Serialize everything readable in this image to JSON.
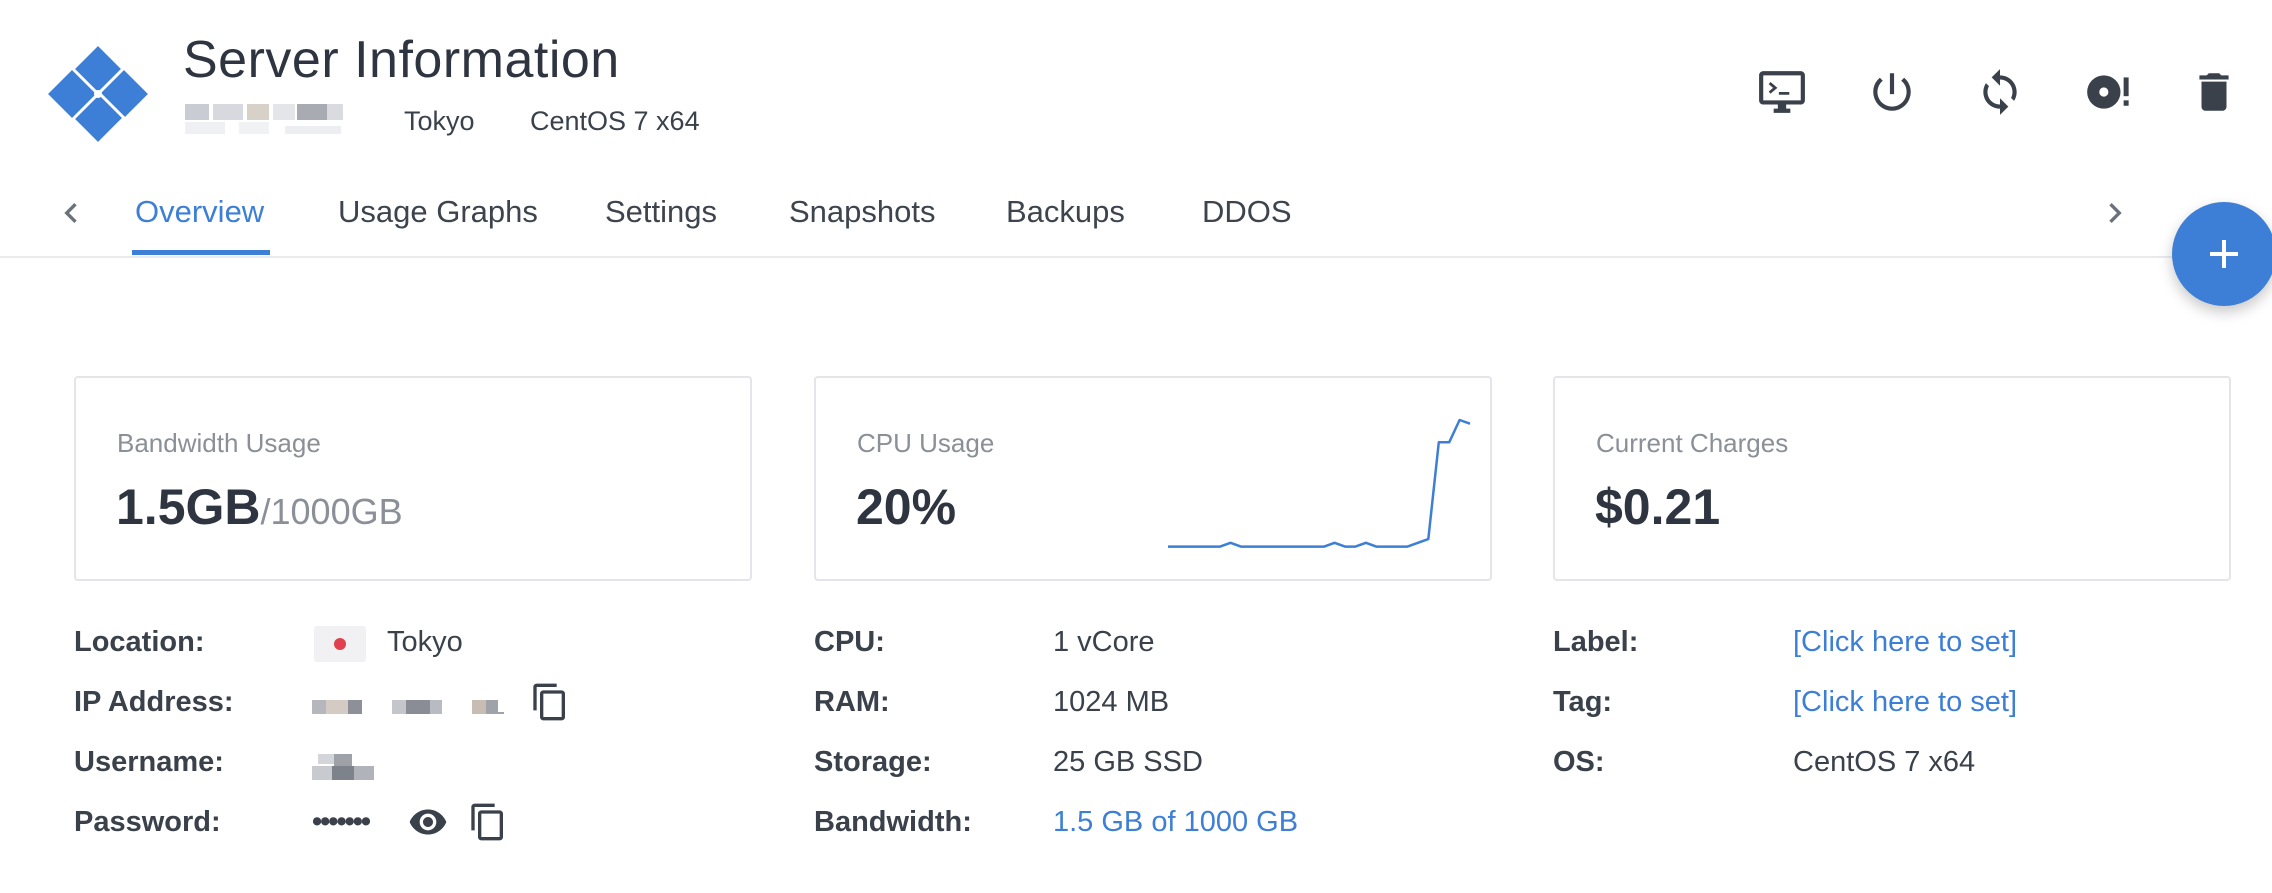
{
  "header": {
    "title": "Server Information",
    "location": "Tokyo",
    "os": "CentOS 7 x64",
    "actions": [
      {
        "name": "console-icon"
      },
      {
        "name": "power-icon"
      },
      {
        "name": "restart-icon"
      },
      {
        "name": "reinstall-icon"
      },
      {
        "name": "trash-icon"
      }
    ]
  },
  "tabs": {
    "items": [
      {
        "label": "Overview",
        "active": true
      },
      {
        "label": "Usage Graphs"
      },
      {
        "label": "Settings"
      },
      {
        "label": "Snapshots"
      },
      {
        "label": "Backups"
      },
      {
        "label": "DDOS"
      }
    ]
  },
  "cards": {
    "bandwidth": {
      "label": "Bandwidth Usage",
      "value": "1.5GB",
      "total": "/1000GB"
    },
    "cpu": {
      "label": "CPU Usage",
      "value": "20%"
    },
    "charges": {
      "label": "Current Charges",
      "value": "$0.21"
    }
  },
  "cpu_sparkline": [
    2,
    2,
    2,
    2,
    2,
    2,
    3,
    2,
    2,
    2,
    2,
    2,
    2,
    2,
    2,
    2,
    3,
    2,
    2,
    3,
    2,
    2,
    2,
    2,
    3,
    4,
    30,
    30,
    36,
    35
  ],
  "info": {
    "left": {
      "location_label": "Location:",
      "location_value": "Tokyo",
      "ip_label": "IP Address:",
      "username_label": "Username:",
      "password_label": "Password:",
      "password_value": "•••••••"
    },
    "middle": {
      "cpu_label": "CPU:",
      "cpu_value": "1 vCore",
      "ram_label": "RAM:",
      "ram_value": "1024 MB",
      "storage_label": "Storage:",
      "storage_value": "25 GB SSD",
      "bandwidth_label": "Bandwidth:",
      "bandwidth_value": "1.5 GB of 1000 GB"
    },
    "right": {
      "label_label": "Label:",
      "label_value": "[Click here to set]",
      "tag_label": "Tag:",
      "tag_value": "[Click here to set]",
      "os_label": "OS:",
      "os_value": "CentOS 7 x64"
    }
  },
  "colors": {
    "accent": "#3d7fd6",
    "text": "#333a44",
    "muted": "#8a8f98",
    "border": "#e3e5ea"
  }
}
